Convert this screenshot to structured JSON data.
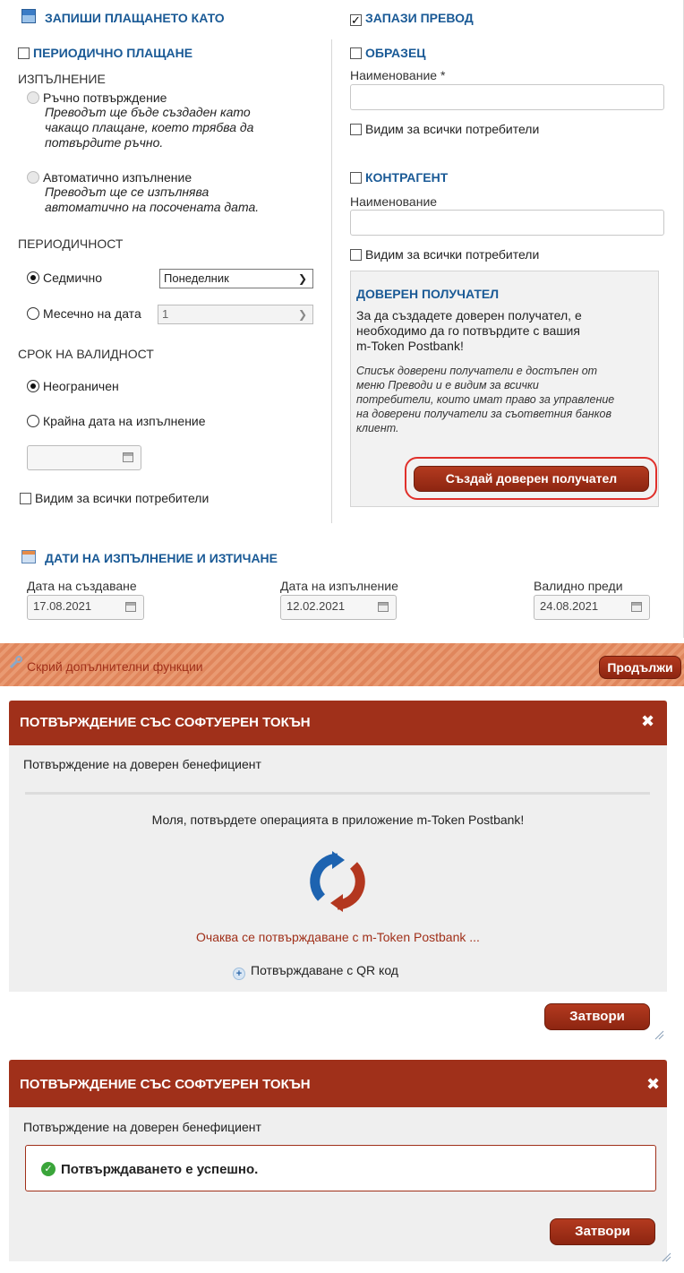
{
  "left": {
    "save_as_title": "ЗАПИШИ ПЛАЩАНЕТО КАТО",
    "periodic_label": "ПЕРИОДИЧНО ПЛАЩАНЕ",
    "execution_heading": "ИЗПЪЛНЕНИЕ",
    "manual": {
      "title": "Ръчно потвърждение",
      "desc1": "Преводът ще бъде създаден като",
      "desc2": "чакащо плащане, което трябва да",
      "desc3": "потвърдите ръчно."
    },
    "auto": {
      "title": "Автоматично изпълнение",
      "desc1": "Преводът ще се изпълнява",
      "desc2": "автоматично на посочената дата."
    },
    "periodicity_heading": "ПЕРИОДИЧНОСТ",
    "weekly_label": "Седмично",
    "weekly_value": "Понеделник",
    "monthly_label": "Месечно на дата",
    "monthly_value": "1",
    "validity_heading": "СРОК НА ВАЛИДНОСТ",
    "unlimited_label": "Неограничен",
    "end_date_label": "Крайна дата на изпълнение",
    "visible_label": "Видим за всички потребители"
  },
  "right": {
    "save_transfer_title": "ЗАПАЗИ ПРЕВОД",
    "template_label": "ОБРАЗЕЦ",
    "template_name_label": "Наименование *",
    "template_visible_label": "Видим за всички потребители",
    "counterparty_label": "КОНТРАГЕНТ",
    "counterparty_name_label": "Наименование",
    "counterparty_visible_label": "Видим за всички потребители",
    "trusted": {
      "title": "ДОВЕРЕН ПОЛУЧАТЕЛ",
      "p1_1": "За да създадете доверен получател, е",
      "p1_2": "необходимо да го потвърдите с вашия",
      "p1_3": "m-Token Postbank!",
      "p2_1": "Списък доверени получатели е достъпен от",
      "p2_2": "меню Преводи и е видим за всички",
      "p2_3": "потребители, които имат право за управление",
      "p2_4": "на доверени получатели за съответния банков",
      "p2_5": "клиент.",
      "button": "Създай доверен получател"
    }
  },
  "dates": {
    "title": "ДАТИ НА ИЗПЪЛНЕНИЕ И ИЗТИЧАНЕ",
    "created_label": "Дата на създаване",
    "created_value": "17.08.2021",
    "execution_label": "Дата на изпълнение",
    "execution_value": "12.02.2021",
    "valid_label": "Валидно преди",
    "valid_value": "24.08.2021"
  },
  "footer": {
    "hide_label": "Скрий допълнителни функции",
    "continue_label": "Продължи"
  },
  "dialog1": {
    "title": "ПОТВЪРЖДЕНИЕ СЪС СОФТУЕРЕН ТОКЪН",
    "subtitle": "Потвърждение на доверен бенефициент",
    "message": "Моля, потвърдете операцията в приложение m-Token Postbank!",
    "waiting": "Очаква се потвърждаване с m-Token Postbank ...",
    "qr_link": "Потвърждаване с QR код",
    "close_label": "Затвори"
  },
  "dialog2": {
    "title": "ПОТВЪРЖДЕНИЕ СЪС СОФТУЕРЕН ТОКЪН",
    "subtitle": "Потвърждение на доверен бенефициент",
    "success": "Потвърждаването е успешно.",
    "close_label": "Затвори"
  },
  "colors": {
    "accent_red": "#a0301a",
    "heading_blue": "#1a5a96",
    "success_green": "#3aa53a"
  }
}
